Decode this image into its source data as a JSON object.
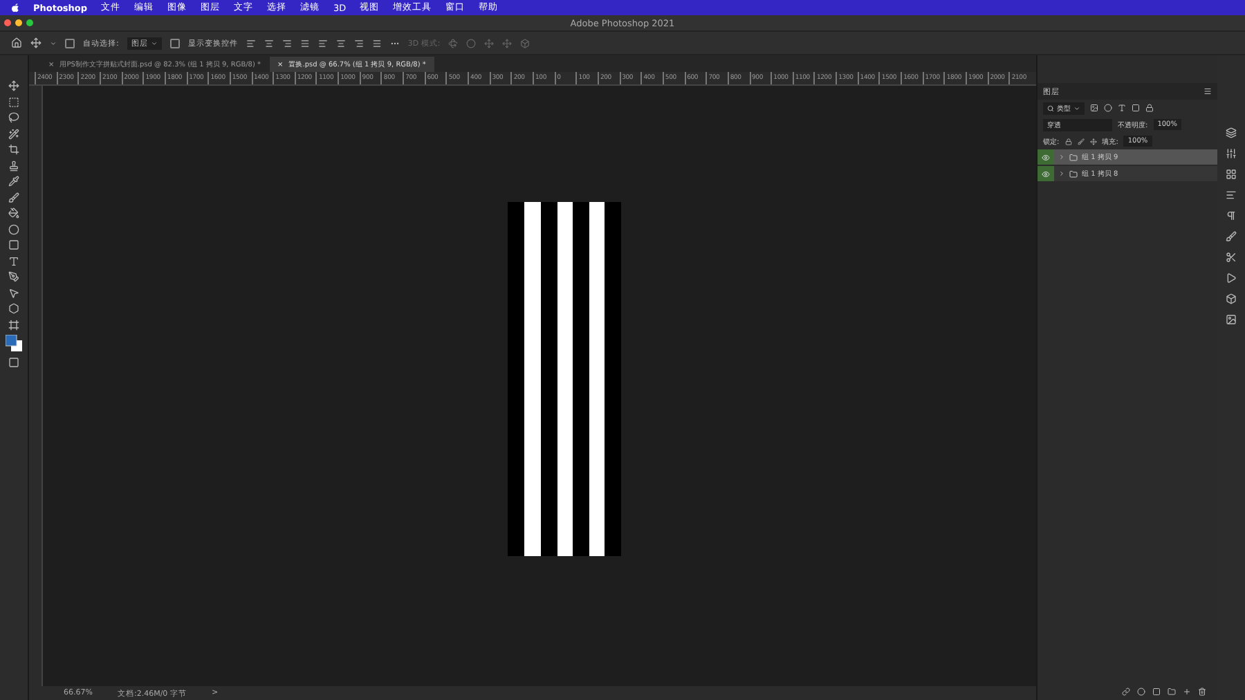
{
  "menu_bar": {
    "app": "Photoshop",
    "items": [
      "文件",
      "编辑",
      "图像",
      "图层",
      "文字",
      "选择",
      "滤镜",
      "3D",
      "视图",
      "增效工具",
      "窗口",
      "帮助"
    ]
  },
  "window": {
    "title": "Adobe Photoshop 2021"
  },
  "options_bar": {
    "auto_select_label": "自动选择:",
    "auto_select_checked": false,
    "auto_select_value": "图层",
    "show_transform_label": "显示变换控件",
    "show_transform_checked": false,
    "mode_3d_label": "3D 模式:"
  },
  "tabs": [
    {
      "close": "×",
      "label": "用PS制作文字拼贴式封面.psd @ 82.3% (组 1 拷贝 9, RGB/8) *",
      "selected": false
    },
    {
      "close": "×",
      "label": "置换.psd @ 66.7% (组 1 拷贝 9, RGB/8) *",
      "selected": true
    }
  ],
  "ruler": [
    "2400",
    "2300",
    "2200",
    "2100",
    "2000",
    "1900",
    "1800",
    "1700",
    "1600",
    "1500",
    "1400",
    "1300",
    "1200",
    "1100",
    "1000",
    "900",
    "800",
    "700",
    "600",
    "500",
    "400",
    "300",
    "200",
    "100",
    "0",
    "100",
    "200",
    "300",
    "400",
    "500",
    "600",
    "700",
    "800",
    "900",
    "1000",
    "1100",
    "1200",
    "1300",
    "1400",
    "1500",
    "1600",
    "1700",
    "1800",
    "1900",
    "2000",
    "2100"
  ],
  "layers_panel": {
    "tab": "图层",
    "filter": "类型",
    "blend_mode": "穿透",
    "opacity_label": "不透明度:",
    "opacity": "100%",
    "lock_label": "锁定:",
    "fill_label": "填充:",
    "fill": "100%",
    "layers": [
      {
        "name": "组 1 拷贝 9",
        "visible": true,
        "selected": true
      },
      {
        "name": "组 1 拷贝 8",
        "visible": true,
        "selected": false
      }
    ]
  },
  "status_bar": {
    "zoom": "66.67%",
    "doc": "文档:2.46M/0 字节",
    "arrow": ">"
  }
}
